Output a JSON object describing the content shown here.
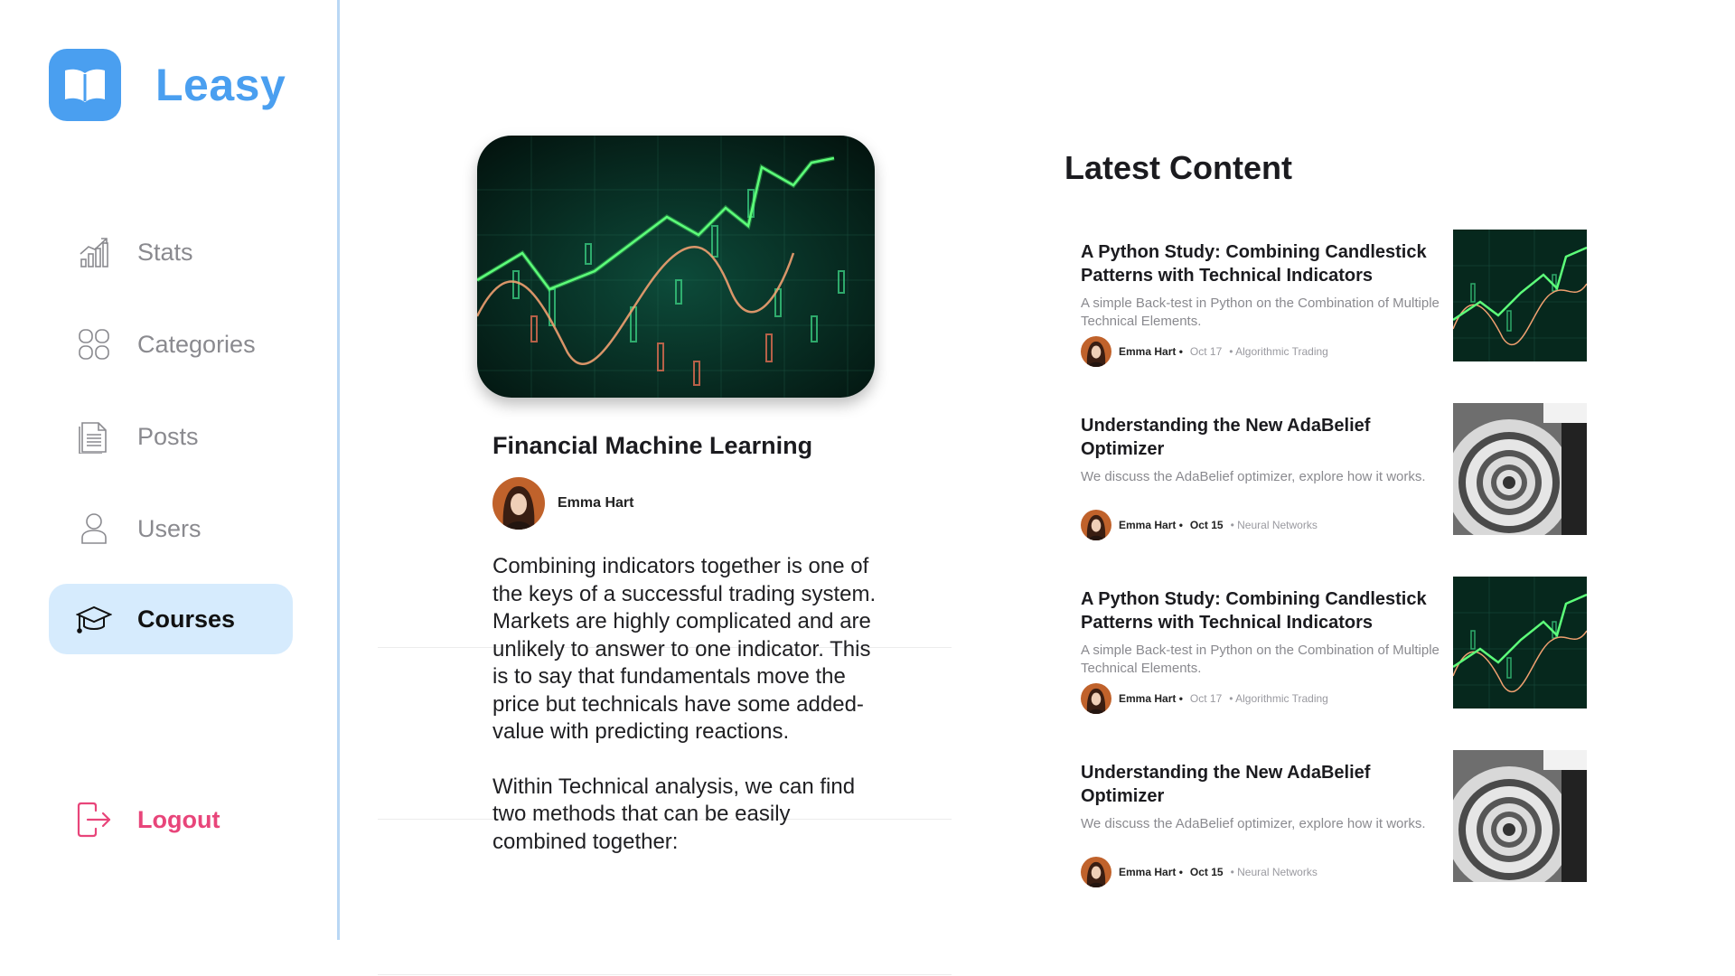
{
  "brand": {
    "name": "Leasy"
  },
  "sidebar": {
    "items": [
      {
        "label": "Stats"
      },
      {
        "label": "Categories"
      },
      {
        "label": "Posts"
      },
      {
        "label": "Users"
      },
      {
        "label": "Courses"
      }
    ],
    "logout_label": "Logout"
  },
  "article": {
    "title": "Financial Machine Learning",
    "author": "Emma Hart",
    "paragraphs": [
      "Combining indicators together is one of the keys of a successful trading system. Markets are highly complicated and are unlikely to answer to one indicator. This is to say that fundamentals move the price but technicals have some added-value with predicting reactions.",
      "Within Technical analysis, we can find two methods that can be easily combined together:"
    ]
  },
  "latest": {
    "heading": "Latest Content",
    "cards": [
      {
        "title": "A Python Study: Combining Candlestick Patterns with Technical Indicators",
        "desc": "A simple Back-test in Python on the Combination of Multiple Technical Elements.",
        "author": "Emma Hart •",
        "date": "Oct 17",
        "category": "• Algorithmic Trading",
        "thumb": "chart"
      },
      {
        "title": "Understanding the New AdaBelief Optimizer",
        "desc": "We discuss the AdaBelief optimizer, explore how it works.",
        "author": "Emma Hart •",
        "date": "Oct 15",
        "category": "• Neural Networks",
        "thumb": "spiral"
      },
      {
        "title": "A Python Study: Combining Candlestick Patterns with Technical Indicators",
        "desc": "A simple Back-test in Python on the Combination of Multiple Technical Elements.",
        "author": "Emma Hart •",
        "date": "Oct 17",
        "category": "• Algorithmic Trading",
        "thumb": "chart"
      },
      {
        "title": "Understanding the New AdaBelief Optimizer",
        "desc": "We discuss the AdaBelief optimizer, explore how it works.",
        "author": "Emma Hart •",
        "date": "Oct 15",
        "category": "• Neural Networks",
        "thumb": "spiral"
      }
    ]
  },
  "colors": {
    "accent": "#4a9ff0",
    "active_bg": "#d6ebfd",
    "logout": "#e8457a",
    "muted": "#8a8a8f"
  }
}
